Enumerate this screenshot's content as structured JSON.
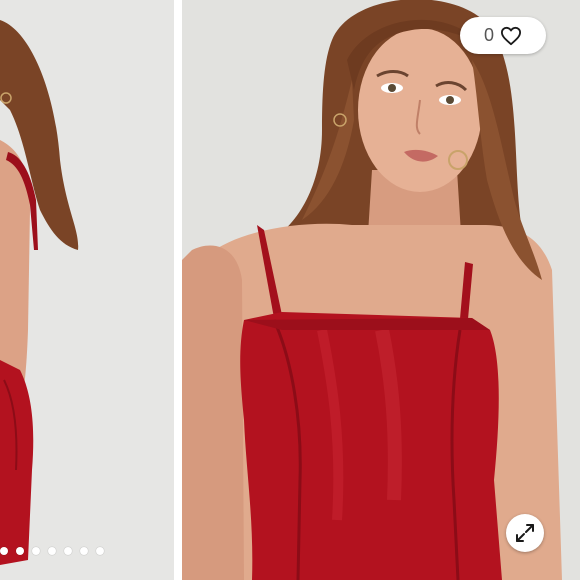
{
  "gallery": {
    "like_count": "0",
    "icons": {
      "like": "heart-outline-icon",
      "expand": "expand-arrows-icon"
    },
    "pagination": {
      "total": 7,
      "active_index": 0
    },
    "colors": {
      "dress": "#b3121f",
      "background": "#e2e2df",
      "skin": "#e0aa8d",
      "hair": "#7a4426"
    }
  }
}
